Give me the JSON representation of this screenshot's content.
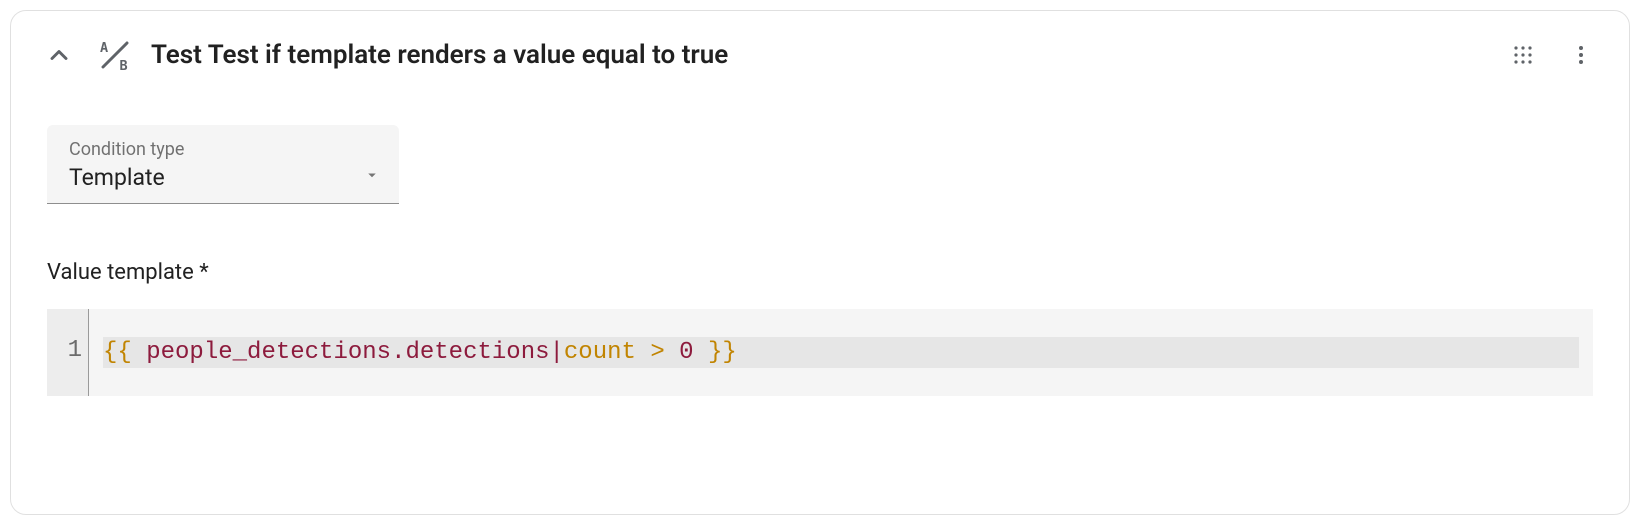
{
  "header": {
    "title": "Test Test if template renders a value equal to true"
  },
  "condition": {
    "type_label": "Condition type",
    "type_value": "Template"
  },
  "template": {
    "label": "Value template *",
    "line_number": "1",
    "tokens": {
      "open": "{{ ",
      "ident": "people_detections",
      "dot": ".",
      "prop": "detections",
      "pipe": "|",
      "filter": "count",
      "space1": " ",
      "op": ">",
      "space2": " ",
      "num": "0",
      "close": " }}"
    }
  }
}
